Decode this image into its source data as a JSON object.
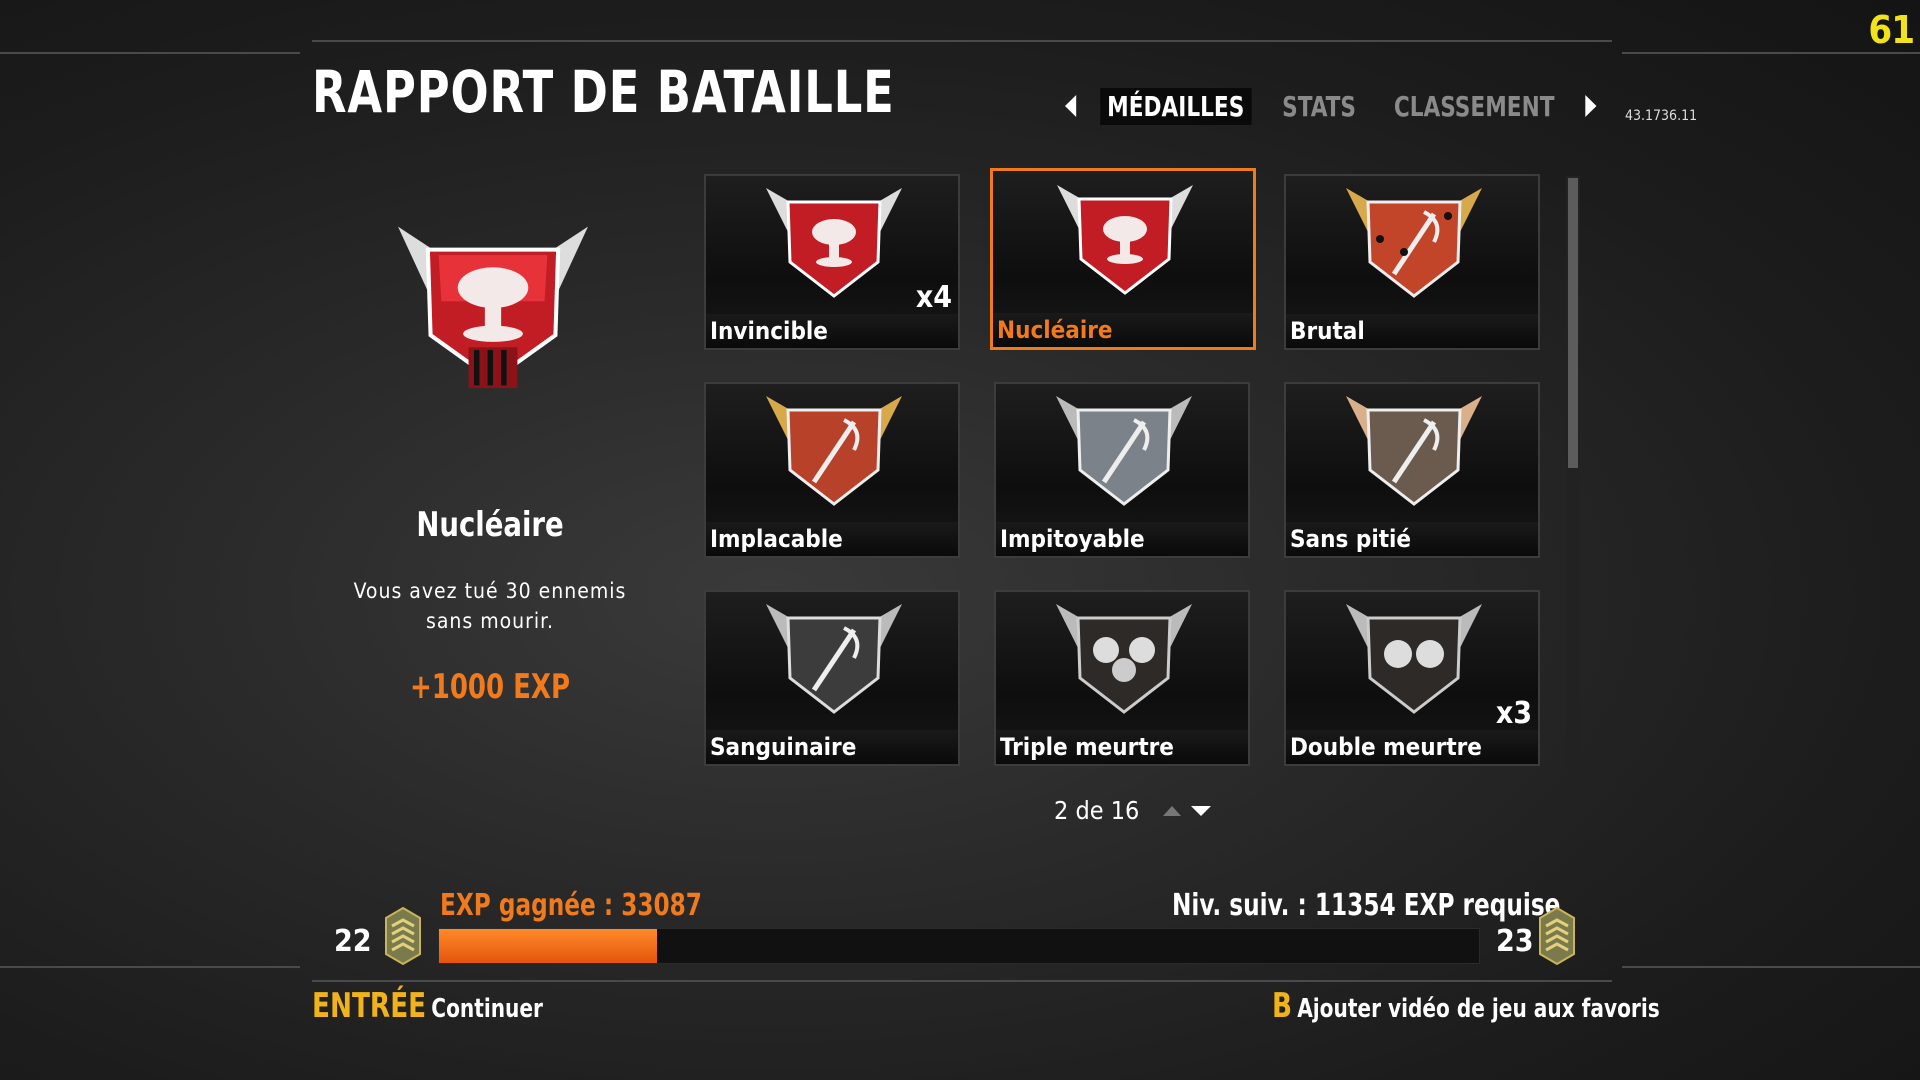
{
  "fps": "61",
  "title": "RAPPORT DE BATAILLE",
  "tabs": [
    {
      "label": "MÉDAILLES",
      "active": true
    },
    {
      "label": "STATS",
      "active": false
    },
    {
      "label": "CLASSEMENT",
      "active": false
    }
  ],
  "version": "43.1736.11",
  "selected": {
    "name": "Nucléaire",
    "description": "Vous avez tué 30 ennemis sans mourir.",
    "exp": "+1000 EXP"
  },
  "medals": [
    {
      "label": "Invincible",
      "count": "x4",
      "emblem": "nuke-medal-icon"
    },
    {
      "label": "Nucléaire",
      "count": "",
      "emblem": "nuke-medal-icon"
    },
    {
      "label": "Brutal",
      "count": "",
      "emblem": "streak-25-medal-icon"
    },
    {
      "label": "Implacable",
      "count": "",
      "emblem": "streak-20-medal-icon"
    },
    {
      "label": "Impitoyable",
      "count": "",
      "emblem": "streak-15-medal-icon"
    },
    {
      "label": "Sans pitié",
      "count": "",
      "emblem": "streak-10-medal-icon"
    },
    {
      "label": "Sanguinaire",
      "count": "",
      "emblem": "streak-5-medal-icon"
    },
    {
      "label": "Triple meurtre",
      "count": "",
      "emblem": "triple-kill-medal-icon"
    },
    {
      "label": "Double meurtre",
      "count": "x3",
      "emblem": "double-kill-medal-icon"
    }
  ],
  "pager": "2 de 16",
  "progress": {
    "exp_gained": "EXP gagnée : 33087",
    "next_level": "Niv. suiv. : 11354 EXP requise",
    "current_level": "22",
    "next_level_num": "23",
    "fill_fraction": 0.21
  },
  "footer": {
    "continue_key": "ENTRÉE",
    "continue_label": "Continuer",
    "fav_key": "B",
    "fav_label": "Ajouter vidéo de jeu aux favoris"
  },
  "colors": {
    "accent": "#f07a1c",
    "fps": "#f2e21a",
    "key": "#f0b31c"
  }
}
